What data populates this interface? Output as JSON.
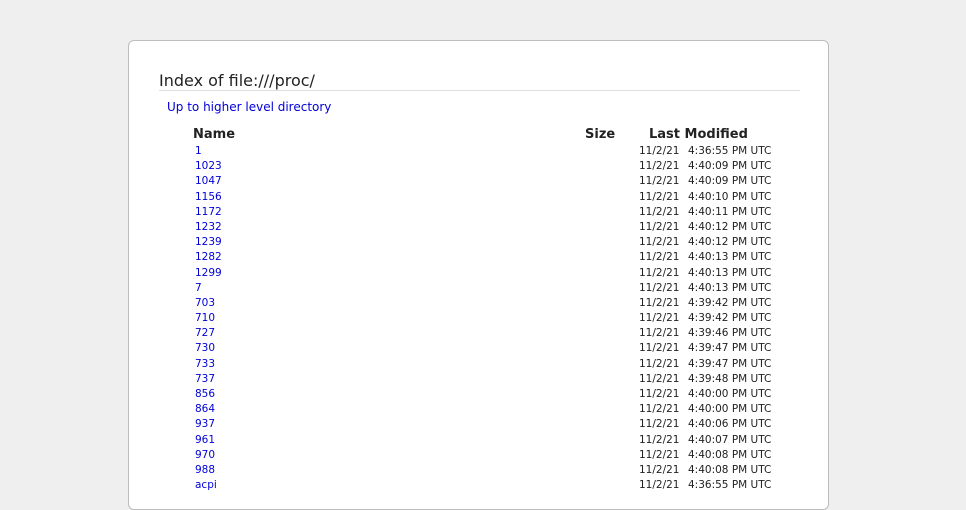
{
  "page": {
    "title": "Index of file:///proc/",
    "up_link": "Up to higher level directory"
  },
  "columns": {
    "name": "Name",
    "size": "Size",
    "last_modified": "Last Modified"
  },
  "entries": [
    {
      "name": "1",
      "date": "11/2/21",
      "time": "4:36:55 PM UTC"
    },
    {
      "name": "1023",
      "date": "11/2/21",
      "time": "4:40:09 PM UTC"
    },
    {
      "name": "1047",
      "date": "11/2/21",
      "time": "4:40:09 PM UTC"
    },
    {
      "name": "1156",
      "date": "11/2/21",
      "time": "4:40:10 PM UTC"
    },
    {
      "name": "1172",
      "date": "11/2/21",
      "time": "4:40:11 PM UTC"
    },
    {
      "name": "1232",
      "date": "11/2/21",
      "time": "4:40:12 PM UTC"
    },
    {
      "name": "1239",
      "date": "11/2/21",
      "time": "4:40:12 PM UTC"
    },
    {
      "name": "1282",
      "date": "11/2/21",
      "time": "4:40:13 PM UTC"
    },
    {
      "name": "1299",
      "date": "11/2/21",
      "time": "4:40:13 PM UTC"
    },
    {
      "name": "7",
      "date": "11/2/21",
      "time": "4:40:13 PM UTC"
    },
    {
      "name": "703",
      "date": "11/2/21",
      "time": "4:39:42 PM UTC"
    },
    {
      "name": "710",
      "date": "11/2/21",
      "time": "4:39:42 PM UTC"
    },
    {
      "name": "727",
      "date": "11/2/21",
      "time": "4:39:46 PM UTC"
    },
    {
      "name": "730",
      "date": "11/2/21",
      "time": "4:39:47 PM UTC"
    },
    {
      "name": "733",
      "date": "11/2/21",
      "time": "4:39:47 PM UTC"
    },
    {
      "name": "737",
      "date": "11/2/21",
      "time": "4:39:48 PM UTC"
    },
    {
      "name": "856",
      "date": "11/2/21",
      "time": "4:40:00 PM UTC"
    },
    {
      "name": "864",
      "date": "11/2/21",
      "time": "4:40:00 PM UTC"
    },
    {
      "name": "937",
      "date": "11/2/21",
      "time": "4:40:06 PM UTC"
    },
    {
      "name": "961",
      "date": "11/2/21",
      "time": "4:40:07 PM UTC"
    },
    {
      "name": "970",
      "date": "11/2/21",
      "time": "4:40:08 PM UTC"
    },
    {
      "name": "988",
      "date": "11/2/21",
      "time": "4:40:08 PM UTC"
    },
    {
      "name": "acpi",
      "date": "11/2/21",
      "time": "4:36:55 PM UTC"
    }
  ]
}
